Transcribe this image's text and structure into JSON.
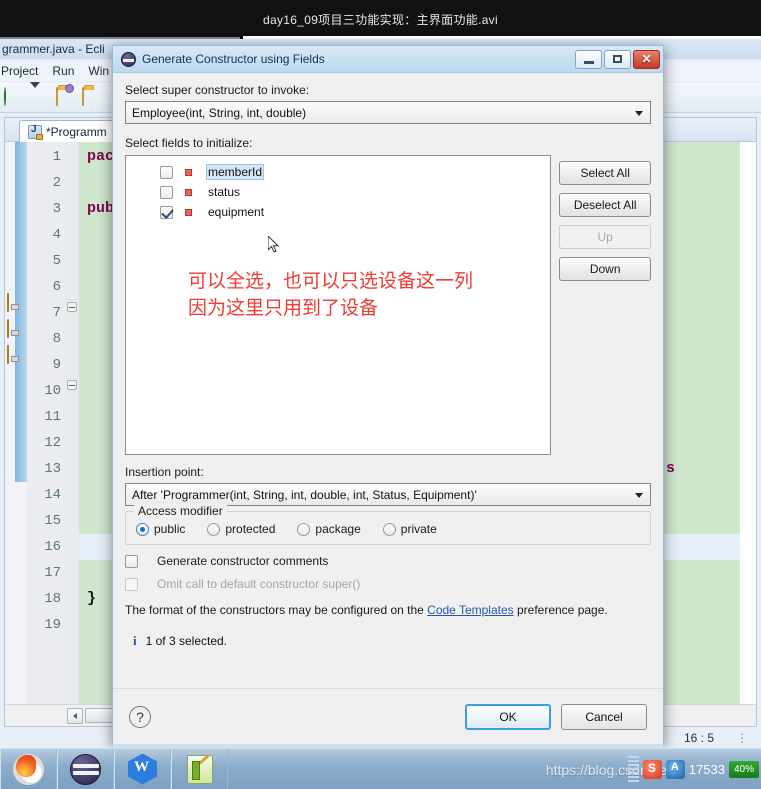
{
  "player": {
    "title": "day16_09项目三功能实现：主界面功能.avi"
  },
  "eclipse": {
    "window_title": "grammer.java - Ecli",
    "menu": [
      "Project",
      "Run",
      "Win"
    ],
    "tab_label": "*Programm",
    "gutter_lines": [
      "1",
      "2",
      "3",
      "4",
      "5",
      "6",
      "7",
      "8",
      "9",
      "10",
      "11",
      "12",
      "13",
      "14",
      "15",
      "16",
      "17",
      "18",
      "19"
    ],
    "code_lines": [
      "pack",
      "pub]",
      "}",
      "double  s"
    ],
    "status_position": "16 : 5"
  },
  "dialog": {
    "title": "Generate Constructor using Fields",
    "window_buttons": {
      "minimize": "minimize-icon",
      "maximize": "maximize-icon",
      "close": "✕"
    },
    "super_label": "Select super constructor to invoke:",
    "super_value": "Employee(int, String, int, double)",
    "fields_label": "Select fields to initialize:",
    "fields": [
      {
        "name": "memberId",
        "checked": false,
        "selected": true
      },
      {
        "name": "status",
        "checked": false,
        "selected": false
      },
      {
        "name": "equipment",
        "checked": true,
        "selected": false
      }
    ],
    "side_buttons": [
      {
        "label": "Select All",
        "disabled": false
      },
      {
        "label": "Deselect All",
        "disabled": false
      },
      {
        "label": "Up",
        "disabled": true
      },
      {
        "label": "Down",
        "disabled": false
      }
    ],
    "annotation": {
      "line1": "可以全选，也可以只选设备这一列",
      "line2": "因为这里只用到了设备",
      "color": "#f03a34"
    },
    "insertion_label": "Insertion point:",
    "insertion_value": "After 'Programmer(int, String, int, double, int, Status, Equipment)'",
    "access_group_label": "Access modifier",
    "access_options": [
      {
        "label": "public",
        "selected": true
      },
      {
        "label": "protected",
        "selected": false
      },
      {
        "label": "package",
        "selected": false
      },
      {
        "label": "private",
        "selected": false
      }
    ],
    "checkboxes": [
      {
        "label": "Generate constructor comments",
        "checked": false,
        "disabled": false
      },
      {
        "label": "Omit call to default constructor super()",
        "checked": false,
        "disabled": true
      }
    ],
    "note_prefix": "The format of the constructors may be configured on the ",
    "note_link": "Code Templates",
    "note_suffix": " preference page.",
    "info_icon": "i",
    "info_text": "1 of 3 selected.",
    "help_icon": "?",
    "ok_label": "OK",
    "cancel_label": "Cancel"
  },
  "taskbar": {
    "items": [
      {
        "name": "firefox-icon"
      },
      {
        "name": "eclipse-icon"
      },
      {
        "name": "wps-icon"
      },
      {
        "name": "notepadpp-icon"
      }
    ],
    "watermark": "https://blog.csdn.net/",
    "tray": {
      "number": "17533",
      "battery": "40%"
    }
  }
}
